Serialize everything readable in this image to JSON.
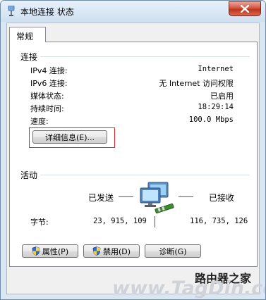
{
  "window": {
    "title": "本地连接 状态",
    "tab": "常规"
  },
  "connection": {
    "heading": "连接",
    "rows": [
      {
        "label": "IPv4 连接:",
        "value": "Internet"
      },
      {
        "label": "IPv6 连接:",
        "value": "无 Internet 访问权限"
      },
      {
        "label": "媒体状态:",
        "value": "已启用"
      },
      {
        "label": "持续时间:",
        "value": "18:29:14"
      },
      {
        "label": "速度:",
        "value": "100.0 Mbps"
      }
    ],
    "details_button": "详细信息(E)..."
  },
  "activity": {
    "heading": "活动",
    "sent_label": "已发送",
    "received_label": "已接收",
    "bytes_label": "字节:",
    "bytes_sent": "23, 915, 109",
    "bytes_received": "116, 735, 126"
  },
  "buttons": {
    "properties": "属性(P)",
    "disable": "禁用(D)",
    "diagnose": "诊断(G)"
  },
  "watermark": {
    "top": "路由器之家",
    "bottom": "www.TagDin.com"
  },
  "colors": {
    "highlight_outline": "#e8212b",
    "title_bar": "#d9e7f5",
    "close_button": "#c1321b"
  }
}
